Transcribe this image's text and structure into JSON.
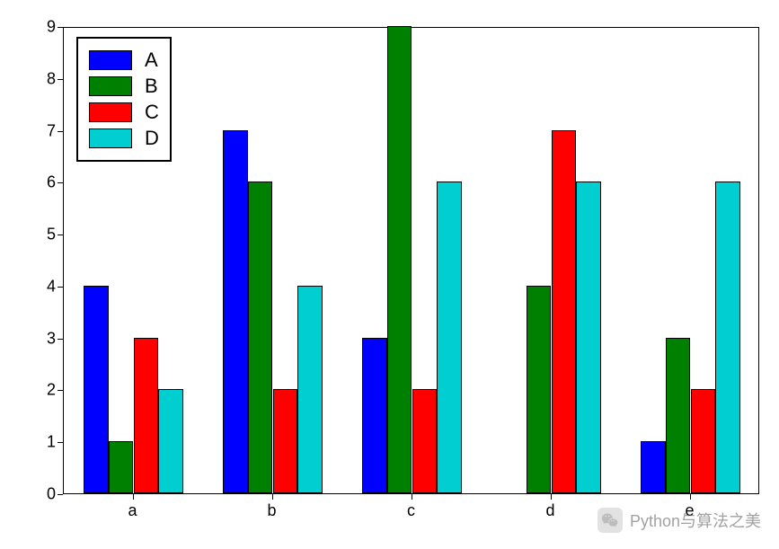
{
  "chart_data": {
    "type": "bar",
    "categories": [
      "a",
      "b",
      "c",
      "d",
      "e"
    ],
    "series": [
      {
        "name": "A",
        "values": [
          4,
          7,
          3,
          0,
          1
        ],
        "color": "#0000ff"
      },
      {
        "name": "B",
        "values": [
          1,
          6,
          9,
          4,
          3
        ],
        "color": "#008000"
      },
      {
        "name": "C",
        "values": [
          3,
          2,
          2,
          7,
          2
        ],
        "color": "#ff0000"
      },
      {
        "name": "D",
        "values": [
          2,
          4,
          6,
          6,
          6
        ],
        "color": "#00ced1"
      }
    ],
    "ylim": [
      0,
      9
    ],
    "yticks": [
      0,
      1,
      2,
      3,
      4,
      5,
      6,
      7,
      8,
      9
    ],
    "xlabel": "",
    "ylabel": "",
    "title": "",
    "legend_position": "upper-left"
  },
  "legend": {
    "items": [
      {
        "label": "A",
        "color": "#0000ff"
      },
      {
        "label": "B",
        "color": "#008000"
      },
      {
        "label": "C",
        "color": "#ff0000"
      },
      {
        "label": "D",
        "color": "#00ced1"
      }
    ]
  },
  "watermark": {
    "text": "Python与算法之美",
    "icon": "wechat"
  }
}
